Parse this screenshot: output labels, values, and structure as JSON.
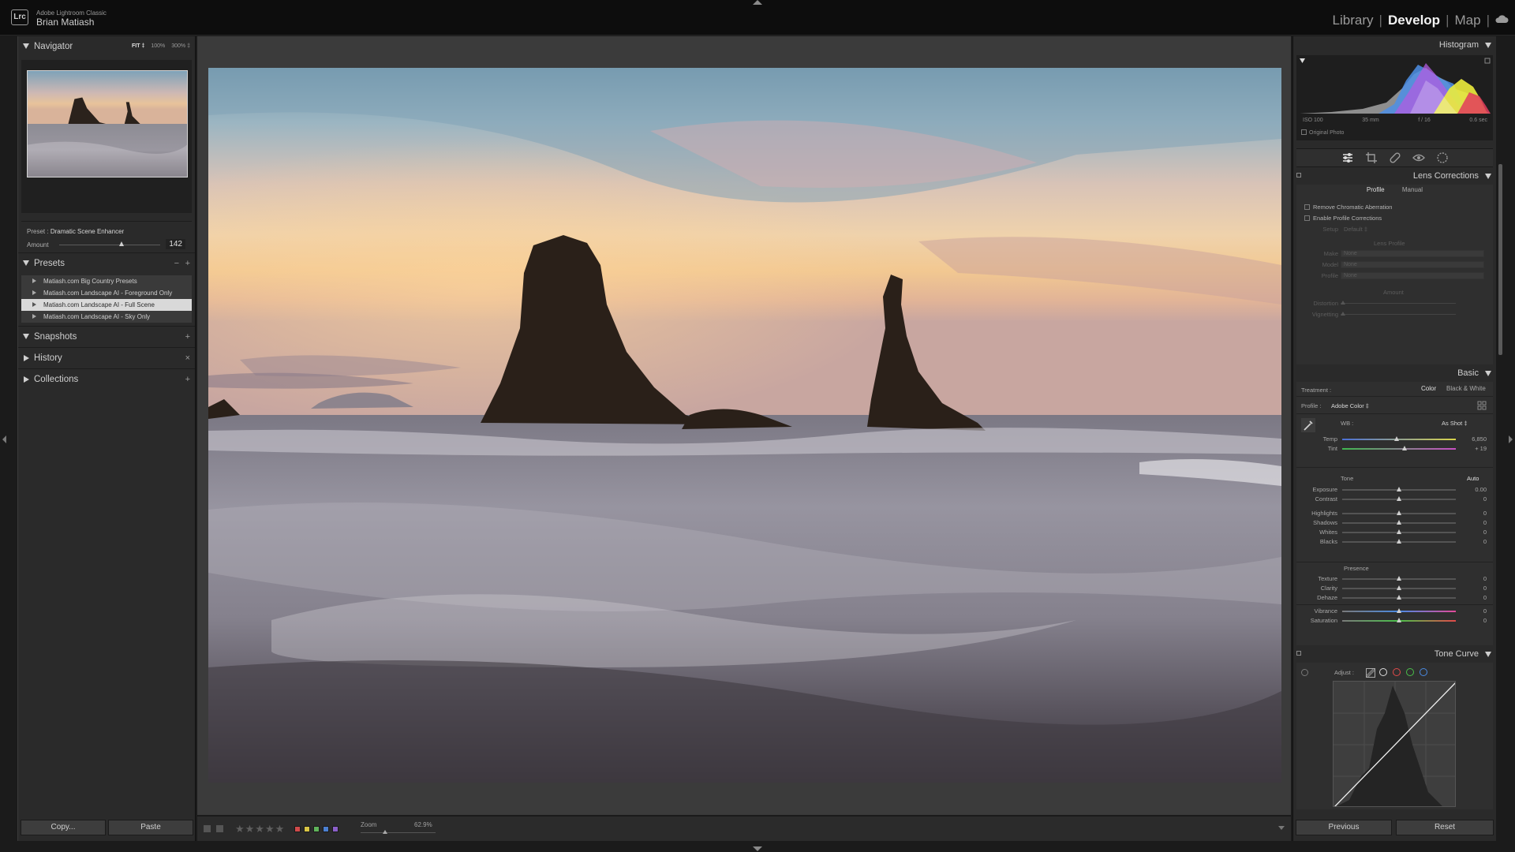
{
  "app": {
    "logo": "Lrc",
    "name": "Adobe Lightroom Classic",
    "user": "Brian Matiash",
    "modules": [
      "Library",
      "Develop",
      "Map"
    ],
    "active_module": "Develop"
  },
  "left_panel": {
    "navigator": {
      "title": "Navigator",
      "zoom_options": [
        "FIT ‡",
        "100%",
        "300% ‡"
      ]
    },
    "preset_amount": {
      "preset_label": "Preset :",
      "preset_name": "Dramatic Scene Enhancer",
      "amount_label": "Amount",
      "amount_value": "142",
      "amount_fraction": 0.62
    },
    "presets": {
      "title": "Presets",
      "minus": "−",
      "plus": "+",
      "items": [
        "Matiash.com Big Country Presets",
        "Matiash.com Landscape AI - Foreground Only",
        "Matiash.com Landscape AI - Full Scene",
        "Matiash.com Landscape AI - Sky Only"
      ],
      "selected_index": 2
    },
    "snapshots": {
      "title": "Snapshots",
      "action": "+"
    },
    "history": {
      "title": "History",
      "action": "×"
    },
    "collections": {
      "title": "Collections",
      "action": "+"
    },
    "copy_label": "Copy...",
    "paste_label": "Paste"
  },
  "toolbar": {
    "stars": "★★★★★",
    "color_labels": [
      "#d04a4a",
      "#d8c544",
      "#5fb35a",
      "#4b7fd0",
      "#8a5fc8"
    ],
    "zoom_label": "Zoom",
    "zoom_value": "62.9%"
  },
  "right_panel": {
    "histogram": {
      "title": "Histogram",
      "iso": "ISO 100",
      "focal": "35 mm",
      "aperture": "f / 16",
      "shutter": "0.6 sec",
      "original_photo": "Original Photo"
    },
    "lens_corrections": {
      "title": "Lens Corrections",
      "tabs": [
        "Profile",
        "Manual"
      ],
      "active_tab": "Profile",
      "remove_ca": "Remove Chromatic Aberration",
      "enable_profile": "Enable Profile Corrections",
      "setup_label": "Setup",
      "setup_value": "Default ‡",
      "lens_profile": "Lens Profile",
      "make_label": "Make",
      "model_label": "Model",
      "profile_label": "Profile",
      "none": "None",
      "amount": "Amount",
      "distortion": "Distortion",
      "vignetting": "Vignetting"
    },
    "basic": {
      "title": "Basic",
      "treatment_label": "Treatment :",
      "treatment_color": "Color",
      "treatment_bw": "Black & White",
      "profile_label": "Profile :",
      "profile_value": "Adobe Color ‡",
      "wb_label": "WB :",
      "wb_value": "As Shot ‡",
      "tone_label": "Tone",
      "auto_label": "Auto",
      "presence_label": "Presence",
      "sliders": [
        {
          "label": "Temp",
          "value": "6,850",
          "pos": 0.48
        },
        {
          "label": "Tint",
          "value": "+ 19",
          "pos": 0.55
        },
        {
          "label": "Exposure",
          "value": "0.00",
          "pos": 0.5
        },
        {
          "label": "Contrast",
          "value": "0",
          "pos": 0.5
        },
        {
          "label": "Highlights",
          "value": "0",
          "pos": 0.5
        },
        {
          "label": "Shadows",
          "value": "0",
          "pos": 0.5
        },
        {
          "label": "Whites",
          "value": "0",
          "pos": 0.5
        },
        {
          "label": "Blacks",
          "value": "0",
          "pos": 0.5
        },
        {
          "label": "Texture",
          "value": "0",
          "pos": 0.5
        },
        {
          "label": "Clarity",
          "value": "0",
          "pos": 0.5
        },
        {
          "label": "Dehaze",
          "value": "0",
          "pos": 0.5
        },
        {
          "label": "Vibrance",
          "value": "0",
          "pos": 0.5
        },
        {
          "label": "Saturation",
          "value": "0",
          "pos": 0.5
        }
      ]
    },
    "tone_curve": {
      "title": "Tone Curve",
      "adjust_label": "Adjust :"
    },
    "previous_label": "Previous",
    "reset_label": "Reset"
  }
}
